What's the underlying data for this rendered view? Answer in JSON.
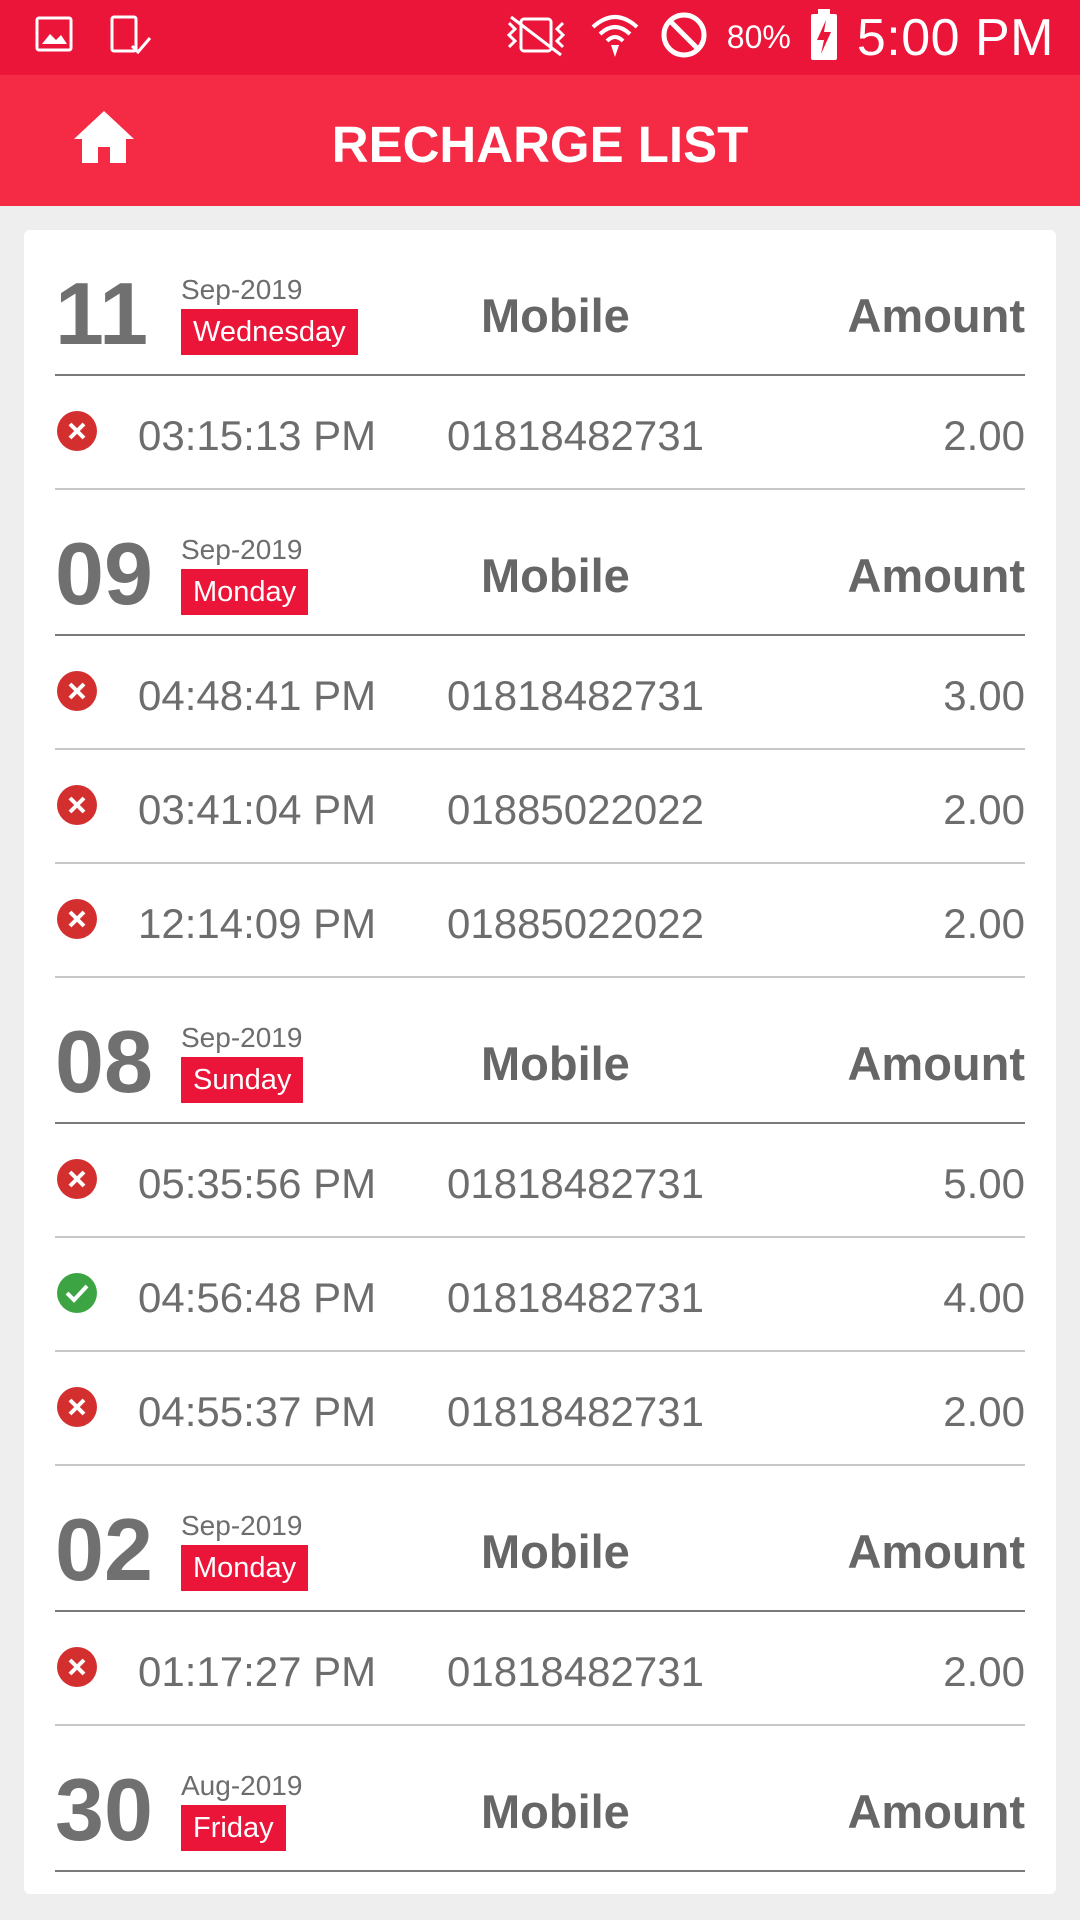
{
  "status_bar": {
    "battery": "80%",
    "time": "5:00 PM",
    "icons": [
      "gallery-icon",
      "device-check-icon",
      "vibrate-icon",
      "wifi-icon",
      "do-not-disturb-icon",
      "battery-charging-icon"
    ]
  },
  "app_bar": {
    "title": "RECHARGE LIST",
    "home_icon": "home-icon"
  },
  "column_labels": {
    "mobile": "Mobile",
    "amount": "Amount"
  },
  "colors": {
    "primary": "#ea1539",
    "success": "#3da444",
    "failed": "#d32f2f"
  },
  "days": [
    {
      "day": "11",
      "month": "Sep-2019",
      "weekday": "Wednesday",
      "mobile_label": "Mobile",
      "amount_label": "Amount",
      "rows": [
        {
          "status": "failed",
          "time": "03:15:13 PM",
          "mobile": "01818482731",
          "amount": "2.00"
        }
      ]
    },
    {
      "day": "09",
      "month": "Sep-2019",
      "weekday": "Monday",
      "mobile_label": "Mobile",
      "amount_label": "Amount",
      "rows": [
        {
          "status": "failed",
          "time": "04:48:41 PM",
          "mobile": "01818482731",
          "amount": "3.00"
        },
        {
          "status": "failed",
          "time": "03:41:04 PM",
          "mobile": "01885022022",
          "amount": "2.00"
        },
        {
          "status": "failed",
          "time": "12:14:09 PM",
          "mobile": "01885022022",
          "amount": "2.00"
        }
      ]
    },
    {
      "day": "08",
      "month": "Sep-2019",
      "weekday": "Sunday",
      "mobile_label": "Mobile",
      "amount_label": "Amount",
      "rows": [
        {
          "status": "failed",
          "time": "05:35:56 PM",
          "mobile": "01818482731",
          "amount": "5.00"
        },
        {
          "status": "success",
          "time": "04:56:48 PM",
          "mobile": "01818482731",
          "amount": "4.00"
        },
        {
          "status": "failed",
          "time": "04:55:37 PM",
          "mobile": "01818482731",
          "amount": "2.00"
        }
      ]
    },
    {
      "day": "02",
      "month": "Sep-2019",
      "weekday": "Monday",
      "mobile_label": "Mobile",
      "amount_label": "Amount",
      "rows": [
        {
          "status": "failed",
          "time": "01:17:27 PM",
          "mobile": "01818482731",
          "amount": "2.00"
        }
      ]
    },
    {
      "day": "30",
      "month": "Aug-2019",
      "weekday": "Friday",
      "mobile_label": "Mobile",
      "amount_label": "Amount",
      "rows": []
    }
  ]
}
